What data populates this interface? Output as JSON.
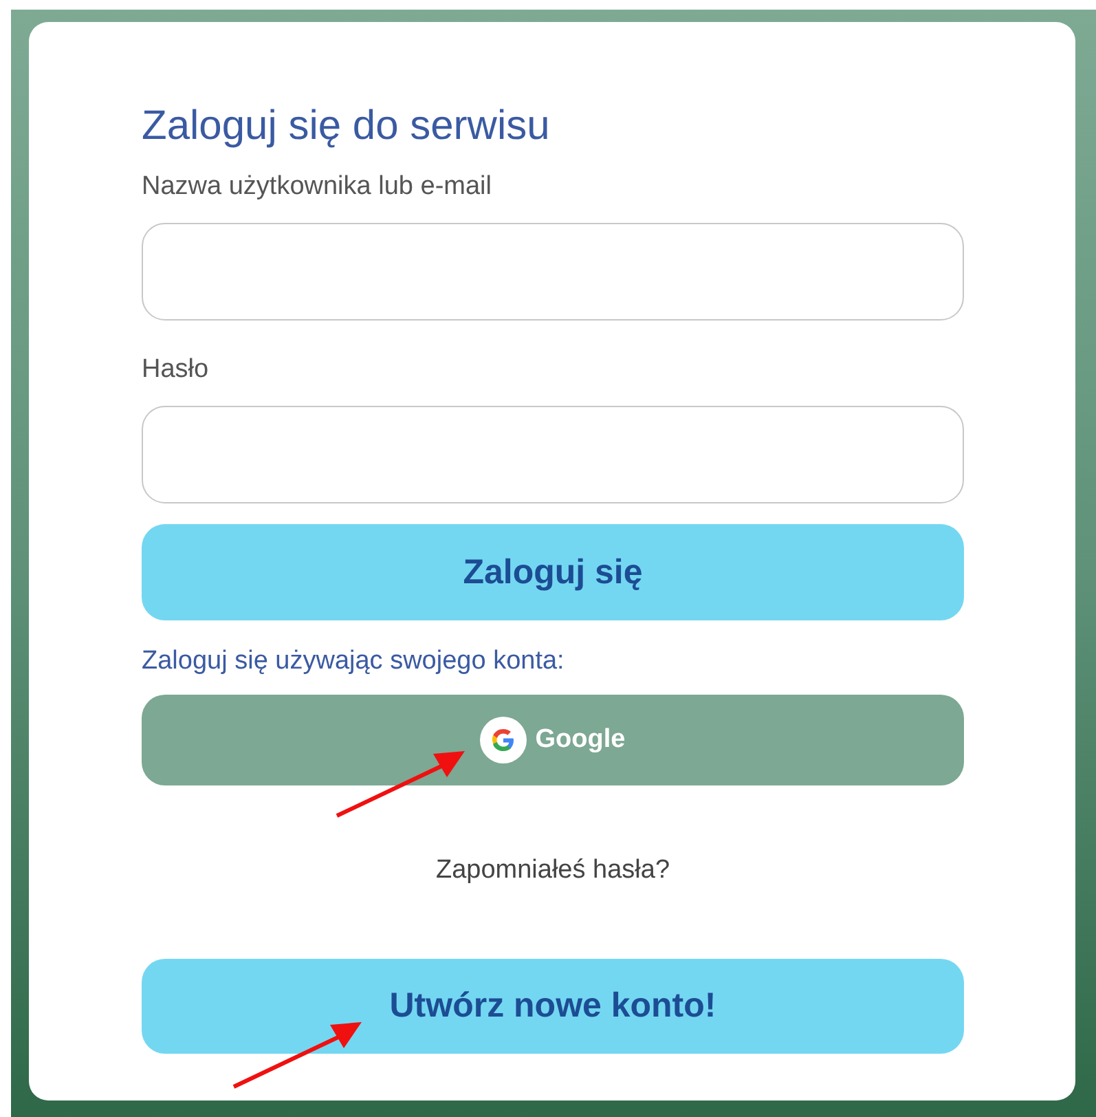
{
  "title": "Zaloguj się do serwisu",
  "fields": [
    {
      "label": "Nazwa użytkownika lub e-mail"
    },
    {
      "label": "Hasło"
    }
  ],
  "login_button": "Zaloguj się",
  "social_label": "Zaloguj się używając swojego konta:",
  "social_button": "Google",
  "forgot_link": "Zapomniałeś hasła?",
  "register_button": "Utwórz nowe konto!"
}
